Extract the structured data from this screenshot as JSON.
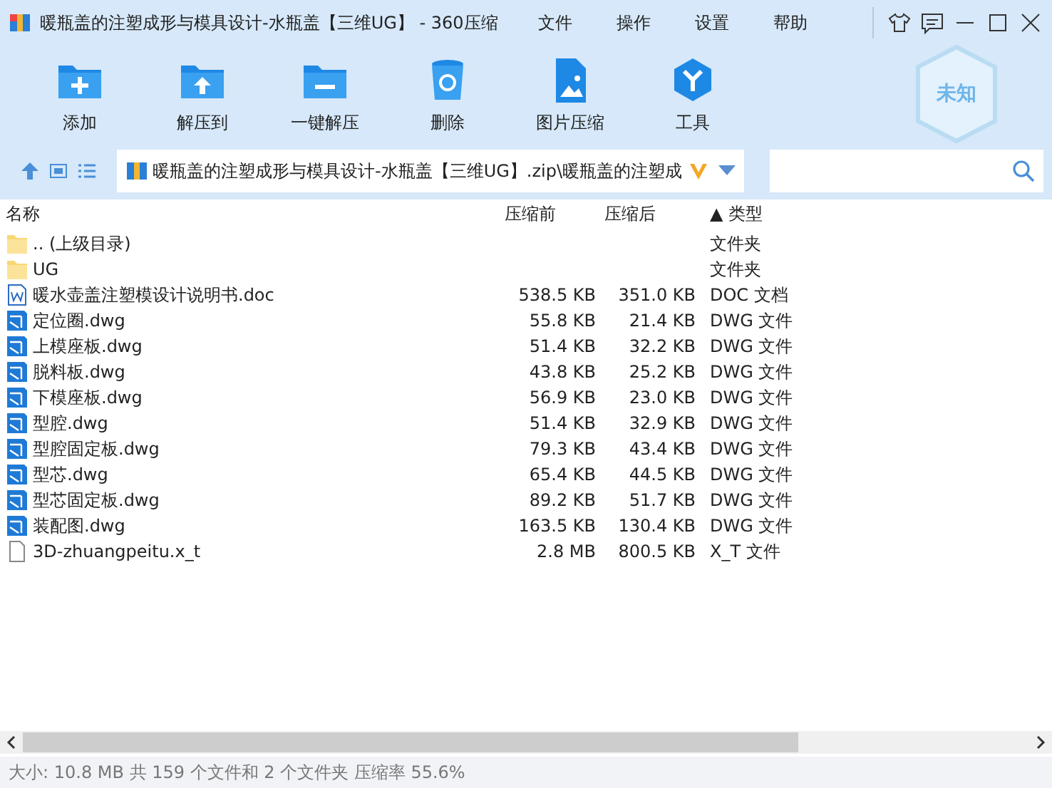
{
  "window": {
    "title": "暖瓶盖的注塑成形与模具设计-水瓶盖【三维UG】 - 360压缩"
  },
  "menu": [
    "文件",
    "操作",
    "设置",
    "帮助"
  ],
  "toolbar": [
    {
      "label": "添加",
      "kind": "add"
    },
    {
      "label": "解压到",
      "kind": "extract"
    },
    {
      "label": "一键解压",
      "kind": "oneclick"
    },
    {
      "label": "删除",
      "kind": "delete"
    },
    {
      "label": "图片压缩",
      "kind": "image"
    },
    {
      "label": "工具",
      "kind": "tools"
    }
  ],
  "badge": "未知",
  "address": {
    "path": "暖瓶盖的注塑成形与模具设计-水瓶盖【三维UG】.zip\\暖瓶盖的注塑成"
  },
  "table": {
    "columns": [
      "名称",
      "压缩前",
      "压缩后",
      "▲ 类型"
    ],
    "rows": [
      {
        "name": ".. (上级目录)",
        "size": "",
        "packed": "",
        "type": "文件夹",
        "kind": "folder"
      },
      {
        "name": "UG",
        "size": "",
        "packed": "",
        "type": "文件夹",
        "kind": "folder"
      },
      {
        "name": "暖水壶盖注塑模设计说明书.doc",
        "size": "538.5 KB",
        "packed": "351.0 KB",
        "type": "DOC 文档",
        "kind": "doc"
      },
      {
        "name": "定位圈.dwg",
        "size": "55.8 KB",
        "packed": "21.4 KB",
        "type": "DWG 文件",
        "kind": "dwg"
      },
      {
        "name": "上模座板.dwg",
        "size": "51.4 KB",
        "packed": "32.2 KB",
        "type": "DWG 文件",
        "kind": "dwg"
      },
      {
        "name": "脱料板.dwg",
        "size": "43.8 KB",
        "packed": "25.2 KB",
        "type": "DWG 文件",
        "kind": "dwg"
      },
      {
        "name": "下模座板.dwg",
        "size": "56.9 KB",
        "packed": "23.0 KB",
        "type": "DWG 文件",
        "kind": "dwg"
      },
      {
        "name": "型腔.dwg",
        "size": "51.4 KB",
        "packed": "32.9 KB",
        "type": "DWG 文件",
        "kind": "dwg"
      },
      {
        "name": "型腔固定板.dwg",
        "size": "79.3 KB",
        "packed": "43.4 KB",
        "type": "DWG 文件",
        "kind": "dwg"
      },
      {
        "name": "型芯.dwg",
        "size": "65.4 KB",
        "packed": "44.5 KB",
        "type": "DWG 文件",
        "kind": "dwg"
      },
      {
        "name": "型芯固定板.dwg",
        "size": "89.2 KB",
        "packed": "51.7 KB",
        "type": "DWG 文件",
        "kind": "dwg"
      },
      {
        "name": "装配图.dwg",
        "size": "163.5 KB",
        "packed": "130.4 KB",
        "type": "DWG 文件",
        "kind": "dwg"
      },
      {
        "name": "3D-zhuangpeitu.x_t",
        "size": "2.8 MB",
        "packed": "800.5 KB",
        "type": "X_T 文件",
        "kind": "file"
      }
    ]
  },
  "status_bar": "大小: 10.8 MB 共 159 个文件和 2 个文件夹 压缩率 55.6%"
}
